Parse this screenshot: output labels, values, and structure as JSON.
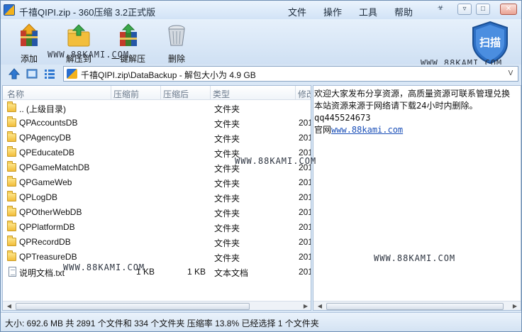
{
  "window": {
    "title": "千禧QIPI.zip - 360压缩 3.2正式版"
  },
  "menu": {
    "file": "文件",
    "actions": "操作",
    "tools": "工具",
    "help": "帮助"
  },
  "titlebar_buttons": {
    "skin": "☣",
    "menu": "▿",
    "minimize": "—",
    "maximize": "□",
    "close": "✕"
  },
  "toolbar": {
    "add": "添加",
    "extract_to": "解压到",
    "one_click_extract": "一键解压",
    "delete": "删除"
  },
  "scan": {
    "label": "扫描"
  },
  "watermarks": {
    "w1": "WWW.88KAMI.COM",
    "w2": "WWW.88KAMI.COM",
    "w3": "WWW.88KAMI.COM",
    "w4": "WWW.88KAMI.COM",
    "w5": "WWW.88KAMI.COM"
  },
  "address": {
    "path": "千禧QIPI.zip\\DataBackup - 解包大小为 4.9 GB",
    "dropdown": "V"
  },
  "columns": {
    "name": "名称",
    "compressed": "压缩前",
    "packed": "压缩后",
    "type": "类型",
    "modified": "修改"
  },
  "files": [
    {
      "name": ".. (上级目录)",
      "size": "",
      "packed": "",
      "type": "文件夹",
      "date": "",
      "kind": "folder"
    },
    {
      "name": "QPAccountsDB",
      "size": "",
      "packed": "",
      "type": "文件夹",
      "date": "201",
      "kind": "folder"
    },
    {
      "name": "QPAgencyDB",
      "size": "",
      "packed": "",
      "type": "文件夹",
      "date": "201",
      "kind": "folder"
    },
    {
      "name": "QPEducateDB",
      "size": "",
      "packed": "",
      "type": "文件夹",
      "date": "201",
      "kind": "folder"
    },
    {
      "name": "QPGameMatchDB",
      "size": "",
      "packed": "",
      "type": "文件夹",
      "date": "201",
      "kind": "folder"
    },
    {
      "name": "QPGameWeb",
      "size": "",
      "packed": "",
      "type": "文件夹",
      "date": "201",
      "kind": "folder"
    },
    {
      "name": "QPLogDB",
      "size": "",
      "packed": "",
      "type": "文件夹",
      "date": "201",
      "kind": "folder"
    },
    {
      "name": "QPOtherWebDB",
      "size": "",
      "packed": "",
      "type": "文件夹",
      "date": "201",
      "kind": "folder"
    },
    {
      "name": "QPPlatformDB",
      "size": "",
      "packed": "",
      "type": "文件夹",
      "date": "201",
      "kind": "folder"
    },
    {
      "name": "QPRecordDB",
      "size": "",
      "packed": "",
      "type": "文件夹",
      "date": "201",
      "kind": "folder"
    },
    {
      "name": "QPTreasureDB",
      "size": "",
      "packed": "",
      "type": "文件夹",
      "date": "201",
      "kind": "folder"
    },
    {
      "name": "说明文档.txt",
      "size": "1 KB",
      "packed": "1 KB",
      "type": "文本文档",
      "date": "201",
      "kind": "doc"
    }
  ],
  "info": {
    "line1": "欢迎大家发布分享资源，高质量资源可联系管理兑换",
    "line2": "本站资源来源于网络请下载24小时内删除。",
    "qq": "qq445524673",
    "site_label": "官网",
    "site_url": "www.88kami.com"
  },
  "status": {
    "text": "大小: 692.6 MB 共 2891 个文件和 334 个文件夹 压缩率 13.8% 已经选择 1 个文件夹"
  }
}
